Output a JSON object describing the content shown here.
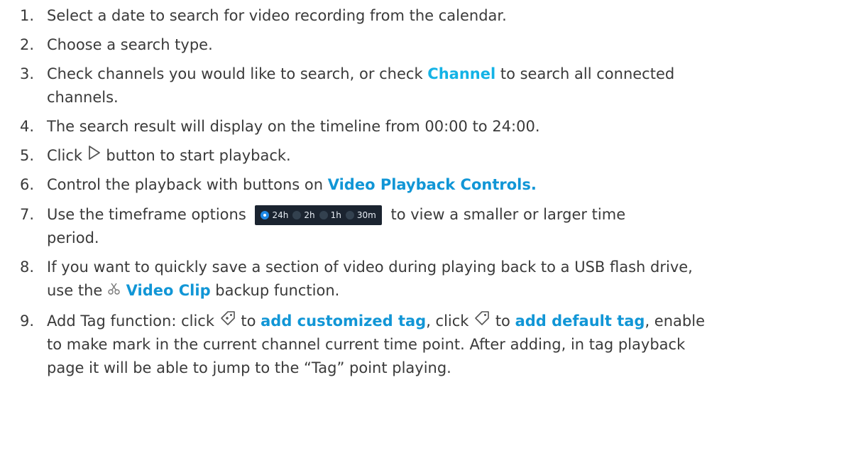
{
  "colors": {
    "accent_blue": "#1196d6",
    "accent_cyan": "#14b3e6",
    "body_text": "#3a3a3a",
    "timeframe_bg": "#1b2430"
  },
  "steps": [
    {
      "num": "1.",
      "text": "Select a date to search for video recording from the calendar."
    },
    {
      "num": "2.",
      "text": "Choose a search type."
    },
    {
      "num": "3.",
      "pre": "Check channels you would like to search, or check ",
      "link": "Channel",
      "post": " to search all connected",
      "line2": "channels."
    },
    {
      "num": "4.",
      "text": "The search result will display on the timeline from 00:00 to 24:00."
    },
    {
      "num": "5.",
      "pre": "Click ",
      "icon": "play-outline-icon",
      "post": " button to start playback."
    },
    {
      "num": "6.",
      "pre": "Control the playback with buttons on ",
      "link": "Video Playback Controls."
    },
    {
      "num": "7.",
      "pre": "Use the timeframe options ",
      "post": " to view a smaller or larger time",
      "line2": "period."
    },
    {
      "num": "8.",
      "text": "If you want to quickly save a section of video during playing back to a USB flash drive,",
      "line2_pre": "use the ",
      "line2_icon": "scissors-icon",
      "line2_link": "Video Clip",
      "line2_post": " backup function."
    },
    {
      "num": "9.",
      "pre": "Add Tag function: click ",
      "icon1": "tag-add-icon",
      "mid1": " to ",
      "link1": "add customized tag",
      "mid2": ", click ",
      "icon2": "tag-icon",
      "mid3": " to ",
      "link2": "add default tag",
      "post": ", enable",
      "line2": "to make mark in the current channel current time point. After adding, in tag playback",
      "line3": "page it will be able to jump to the “Tag” point playing."
    }
  ],
  "timeframe_options": [
    {
      "label": "24h",
      "selected": true
    },
    {
      "label": "2h",
      "selected": false
    },
    {
      "label": "1h",
      "selected": false
    },
    {
      "label": "30m",
      "selected": false
    }
  ]
}
